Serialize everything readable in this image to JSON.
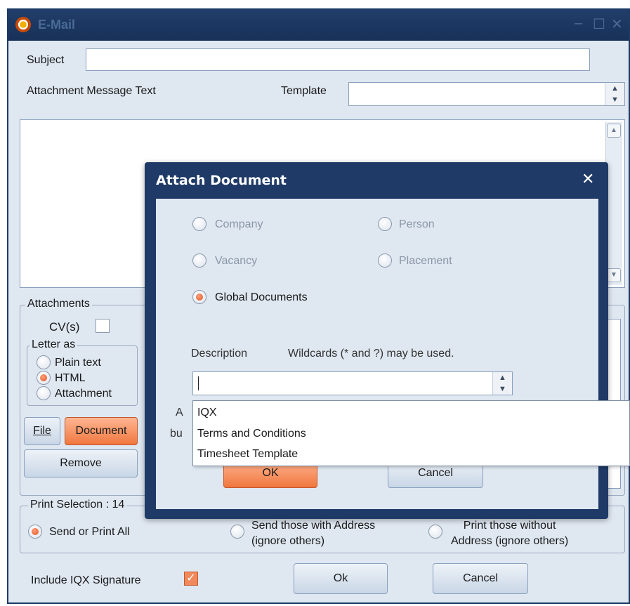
{
  "window": {
    "title": "E-Mail",
    "subject_label": "Subject",
    "subject_value": "",
    "attachment_text_label": "Attachment Message Text",
    "template_label": "Template",
    "template_value": "",
    "attachments": {
      "group_label": "Attachments",
      "cvs_label": "CV(s)",
      "cvs_checked": false,
      "letter_as_label": "Letter as",
      "options": [
        {
          "label": "Plain text",
          "selected": false
        },
        {
          "label": "HTML",
          "selected": true
        },
        {
          "label": "Attachment",
          "selected": false
        }
      ],
      "file_button": "File",
      "document_button": "Document",
      "remove_button": "Remove"
    },
    "print_selection": {
      "group_label": "Print Selection : 14",
      "options": [
        {
          "label": "Send or Print All",
          "selected": true
        },
        {
          "label": "Send those with Address (ignore others)",
          "line1": "Send those with Address",
          "line2": "(ignore others)",
          "selected": false
        },
        {
          "label": "Print those without Address (ignore others)",
          "line1": "Print those without",
          "line2": "Address (ignore others)",
          "selected": false
        }
      ]
    },
    "signature_label": "Include IQX Signature",
    "signature_checked": true,
    "ok_button": "Ok",
    "cancel_button": "Cancel"
  },
  "dialog": {
    "title": "Attach Document",
    "radios": [
      {
        "label": "Company",
        "selected": false,
        "enabled": false
      },
      {
        "label": "Person",
        "selected": false,
        "enabled": false
      },
      {
        "label": "Vacancy",
        "selected": false,
        "enabled": false
      },
      {
        "label": "Placement",
        "selected": false,
        "enabled": false
      },
      {
        "label": "Global Documents",
        "selected": true,
        "enabled": true
      }
    ],
    "description_label": "Description",
    "wildcards_hint": "Wildcards (* and ?) may be used.",
    "description_value": "",
    "dropdown_items": [
      "IQX",
      "Terms and Conditions",
      "Timesheet Template"
    ],
    "hidden_label_a": "A",
    "hidden_label_b": "bu",
    "ok_button": "OK",
    "cancel_button": "Cancel"
  },
  "colors": {
    "titlebar": "#1f3a66",
    "window_bg": "#dfe7f1",
    "accent": "#f0773f"
  }
}
